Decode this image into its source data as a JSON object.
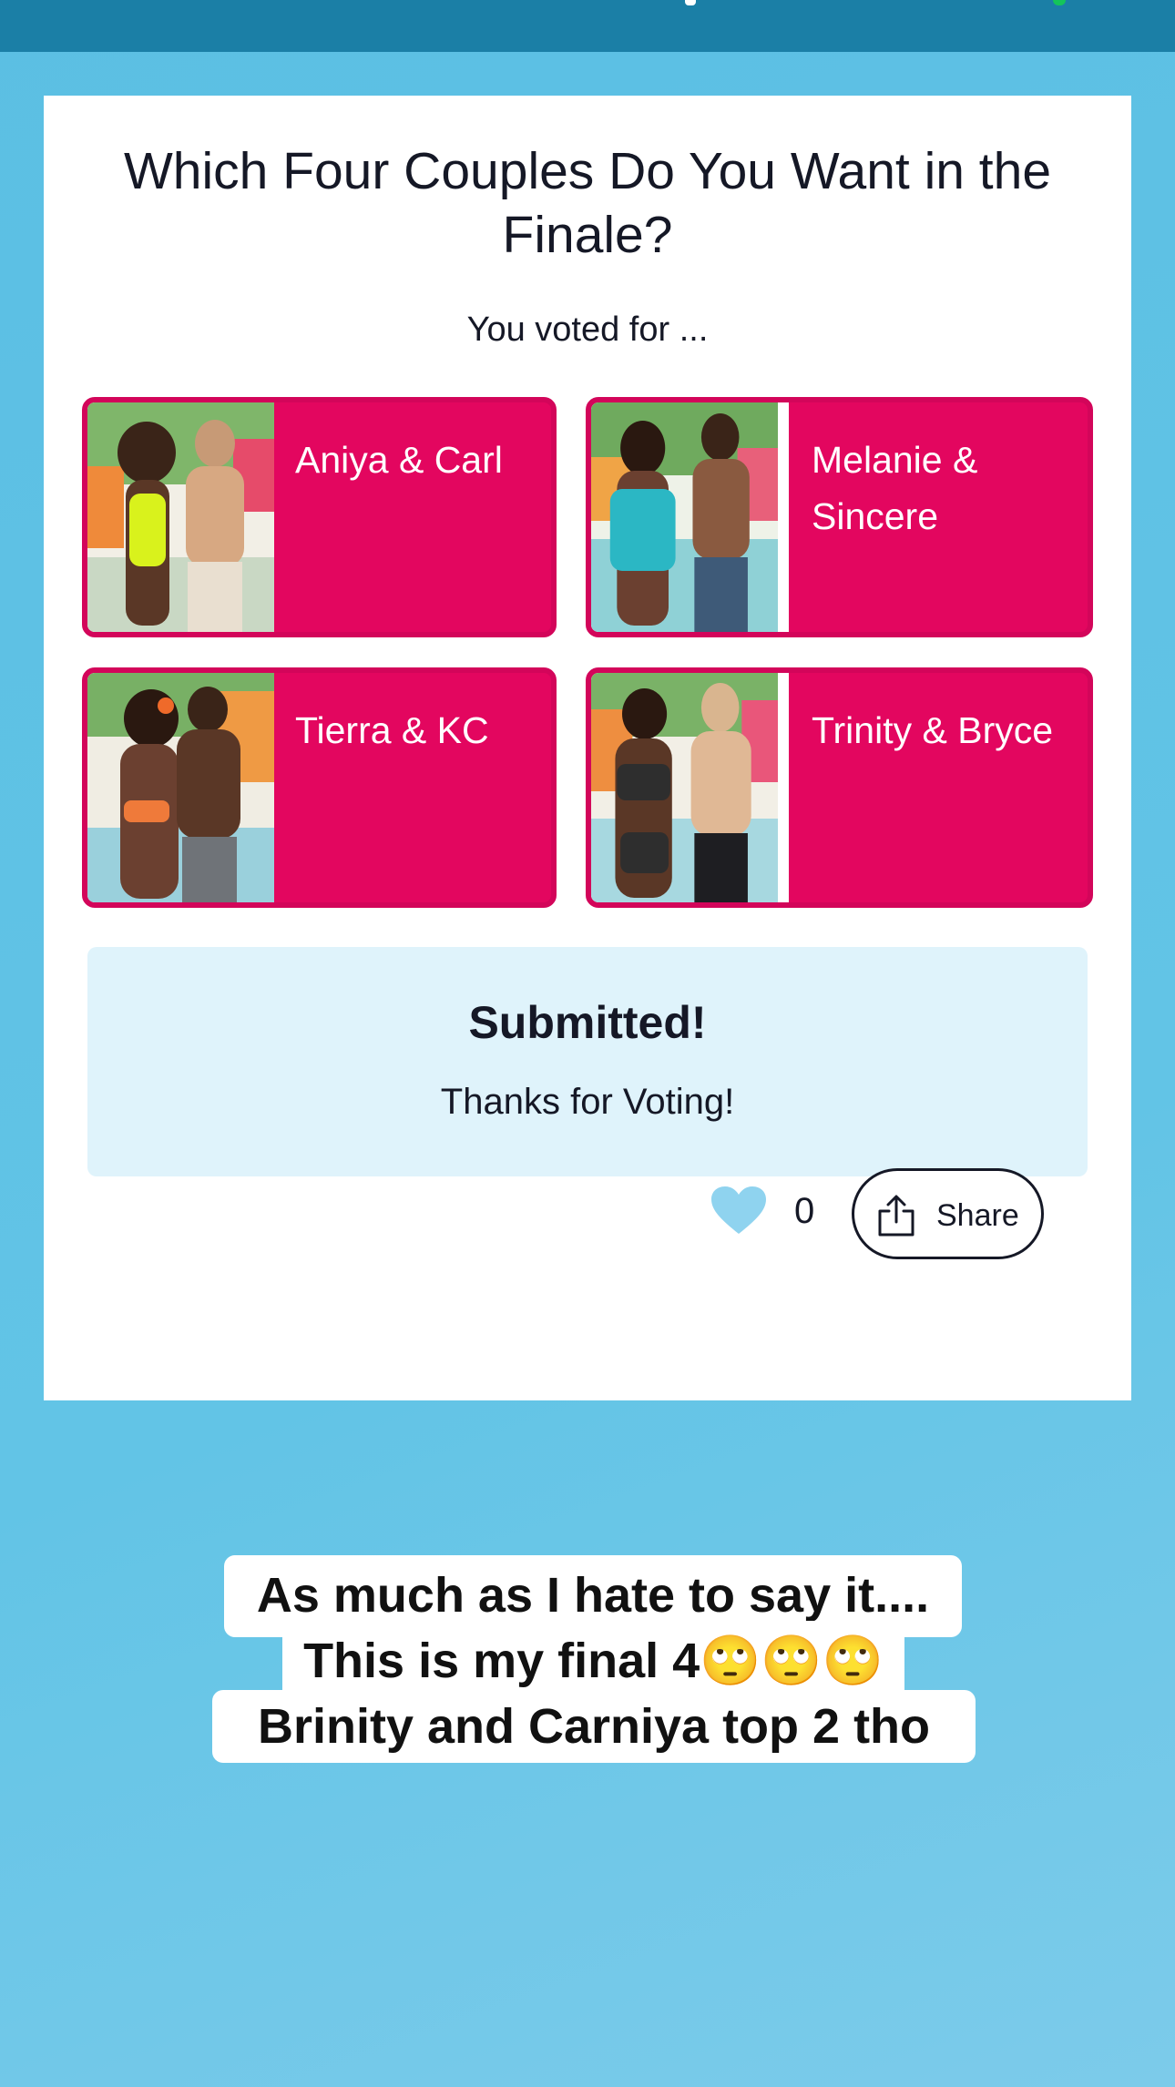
{
  "poll": {
    "question": "Which Four Couples Do You Want in the Finale?",
    "voted_label": "You voted for ...",
    "choices": [
      {
        "name": "Aniya & Carl"
      },
      {
        "name": "Melanie & Sincere"
      },
      {
        "name": "Tierra & KC"
      },
      {
        "name": "Trinity & Bryce"
      }
    ],
    "submitted": {
      "title": "Submitted!",
      "message": "Thanks for Voting!"
    },
    "like_count": "0",
    "share_label": "Share"
  },
  "caption": {
    "lines": [
      "As much as I hate to say it....",
      "This is my final 4🙄🙄🙄",
      "Brinity and Carniya top 2 tho"
    ]
  },
  "colors": {
    "accent": "#e3065f",
    "top_bar": "#1b7fa6",
    "submitted_bg": "#dff3fb",
    "heart": "#8fd3ef"
  },
  "icons": [
    "heart-icon",
    "share-icon"
  ]
}
